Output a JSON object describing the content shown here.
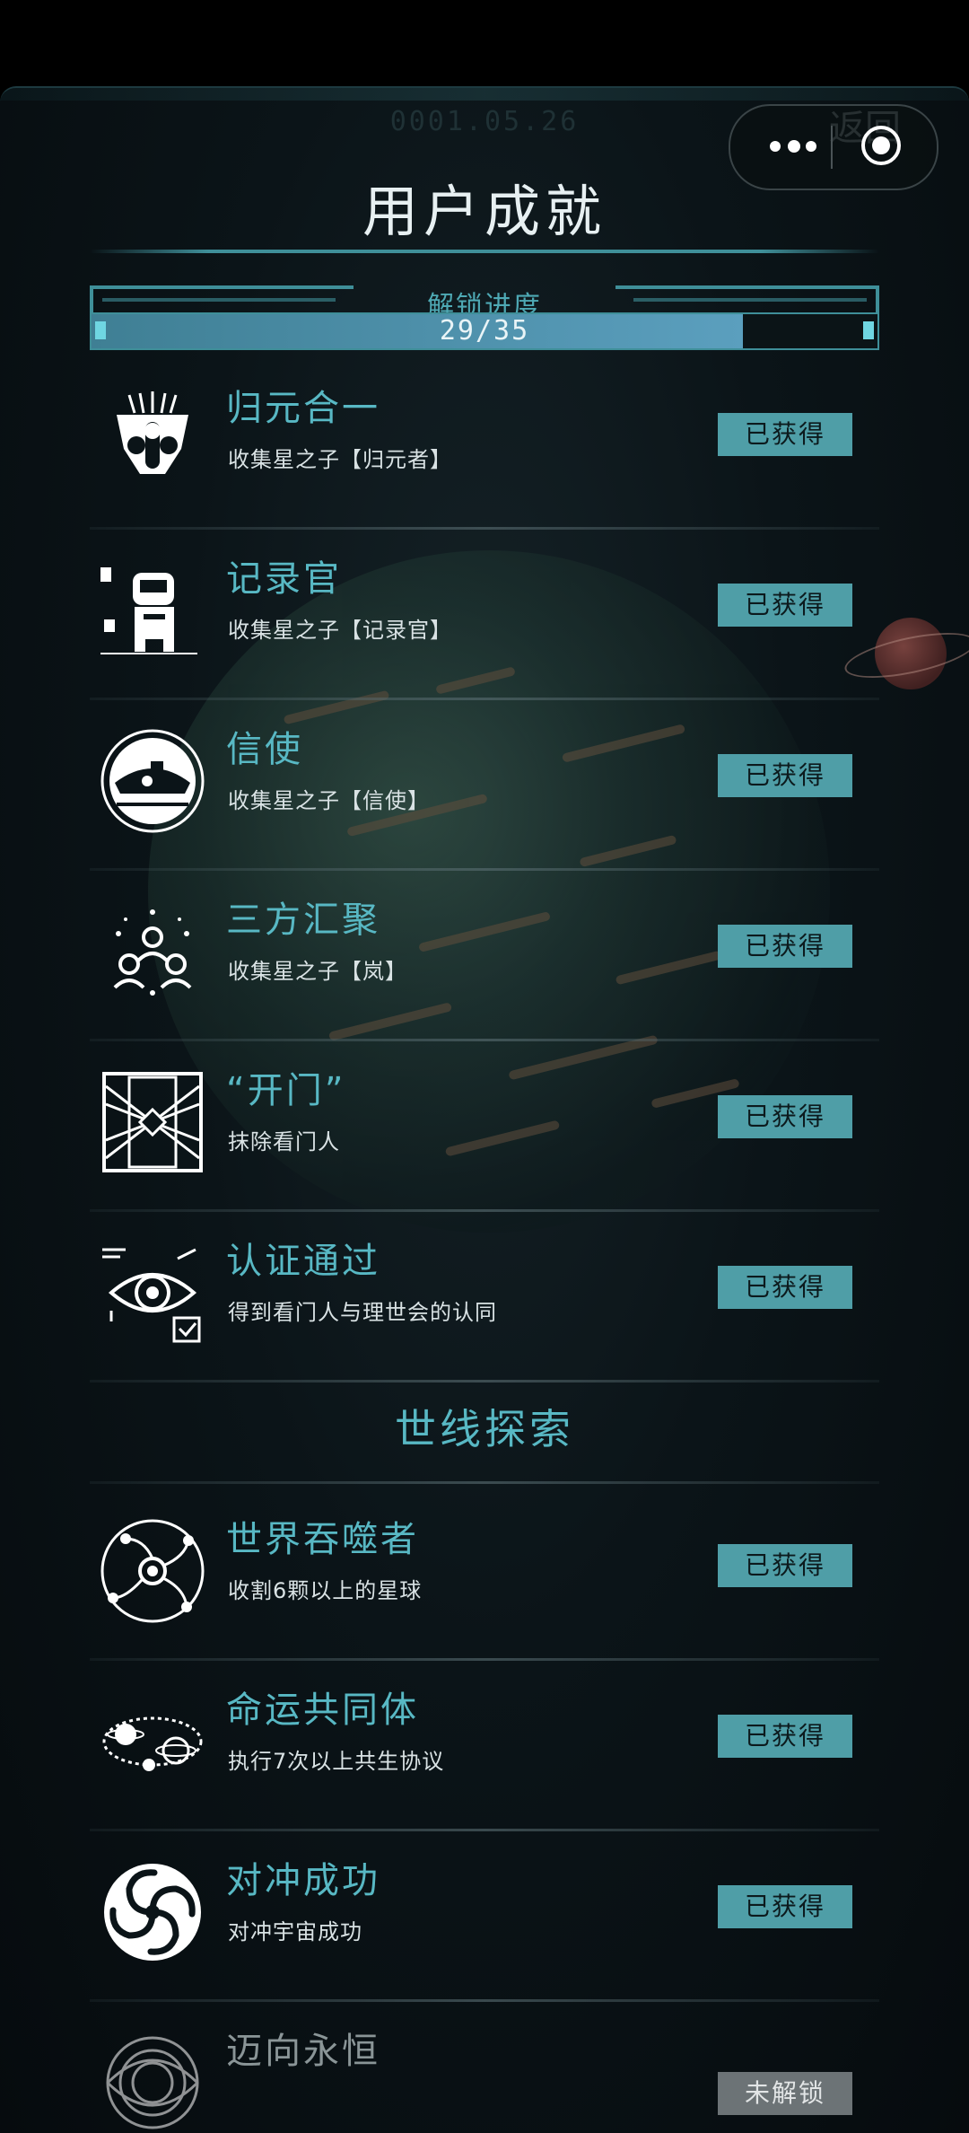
{
  "header": {
    "date_stamp": "0001.05.26",
    "back_label": "返回",
    "title": "用户成就"
  },
  "progress": {
    "label": "解锁进度",
    "text": "29/35",
    "unlocked": 29,
    "total": 35
  },
  "colors": {
    "accent": "#58b8c4",
    "badge_obtained": "#4f9ea7",
    "badge_locked": "#6c7376"
  },
  "achievements": [
    {
      "icon": "tribal-mask-icon",
      "title": "归元合一",
      "desc": "收集星之子【归元者】",
      "status": "已获得"
    },
    {
      "icon": "robot-recorder-icon",
      "title": "记录官",
      "desc": "收集星之子【记录官】",
      "status": "已获得"
    },
    {
      "icon": "submarine-messenger-icon",
      "title": "信使",
      "desc": "收集星之子【信使】",
      "status": "已获得"
    },
    {
      "icon": "people-gathering-icon",
      "title": "三方汇聚",
      "desc": "收集星之子【岚】",
      "status": "已获得"
    },
    {
      "icon": "door-gate-icon",
      "title": "“开门”",
      "desc": "抹除看门人",
      "status": "已获得"
    },
    {
      "icon": "eye-check-icon",
      "title": "认证通过",
      "desc": "得到看门人与理世会的认同",
      "status": "已获得"
    }
  ],
  "section2": {
    "title": "世线探索"
  },
  "exploration": [
    {
      "icon": "world-devourer-icon",
      "title": "世界吞噬者",
      "desc": "收割6颗以上的星球",
      "status": "已获得"
    },
    {
      "icon": "orbit-community-icon",
      "title": "命运共同体",
      "desc": "执行7次以上共生协议",
      "status": "已获得"
    },
    {
      "icon": "spiral-vortex-icon",
      "title": "对冲成功",
      "desc": "对冲宇宙成功",
      "status": "已获得"
    },
    {
      "icon": "eternal-galaxy-icon",
      "title": "迈向永恒",
      "desc": "",
      "status": "未解锁"
    }
  ]
}
